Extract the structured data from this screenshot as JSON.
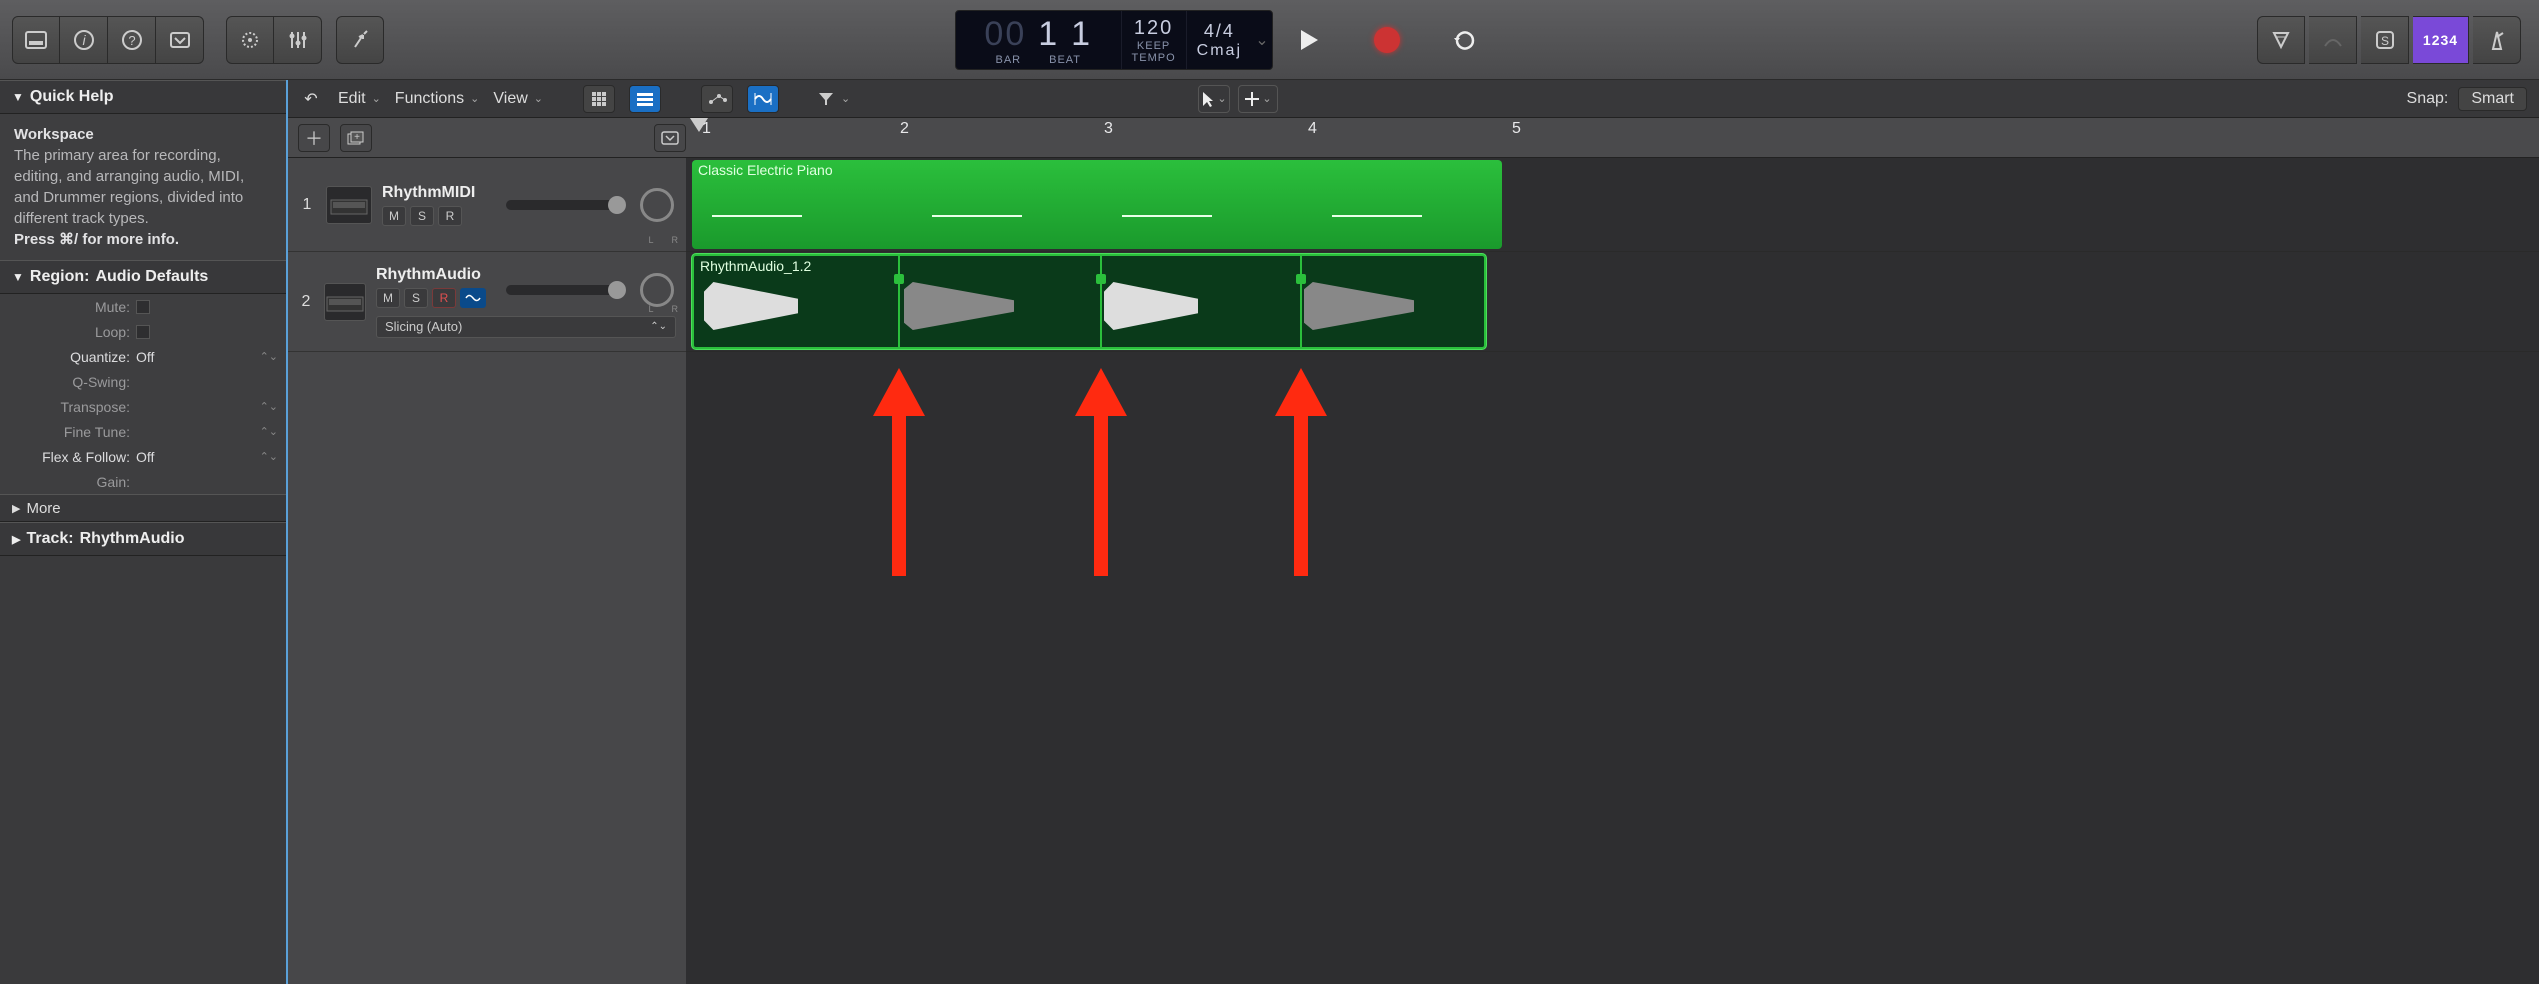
{
  "lcd": {
    "bar_prefix": "00",
    "bar_value": "1",
    "beat_value": "1",
    "bar_label": "BAR",
    "beat_label": "BEAT",
    "tempo_value": "120",
    "tempo_sub": "KEEP",
    "tempo_label": "TEMPO",
    "sig_value": "4/4",
    "key_value": "Cmaj"
  },
  "right_toolbar": {
    "count_in": "1234"
  },
  "quickhelp": {
    "title": "Quick Help",
    "subject": "Workspace",
    "body": "The primary area for recording, editing, and arranging audio, MIDI, and Drummer regions, divided into different track types.",
    "more": "Press ⌘/ for more info."
  },
  "region_panel": {
    "title_prefix": "Region:",
    "title_value": "Audio Defaults",
    "rows": {
      "mute": "Mute:",
      "loop": "Loop:",
      "quantize": "Quantize:",
      "quantize_val": "Off",
      "qswing": "Q-Swing:",
      "transpose": "Transpose:",
      "finetune": "Fine Tune:",
      "flexfollow": "Flex & Follow:",
      "flexfollow_val": "Off",
      "gain": "Gain:"
    },
    "more": "More"
  },
  "track_panel": {
    "title_prefix": "Track:",
    "title_value": "RhythmAudio"
  },
  "menubar": {
    "edit": "Edit",
    "functions": "Functions",
    "view": "View",
    "snap_label": "Snap:",
    "snap_value": "Smart"
  },
  "ruler": {
    "bars": [
      "1",
      "2",
      "3",
      "4",
      "5"
    ]
  },
  "tracks": [
    {
      "num": "1",
      "name": "RhythmMIDI",
      "buttons": {
        "m": "M",
        "s": "S",
        "r": "R"
      },
      "region_name": "Classic Electric Piano"
    },
    {
      "num": "2",
      "name": "RhythmAudio",
      "buttons": {
        "m": "M",
        "s": "S",
        "r": "R"
      },
      "flex_mode": "Slicing (Auto)",
      "region_name": "RhythmAudio_1.2"
    }
  ],
  "pan_labels": {
    "l": "L",
    "r": "R"
  }
}
